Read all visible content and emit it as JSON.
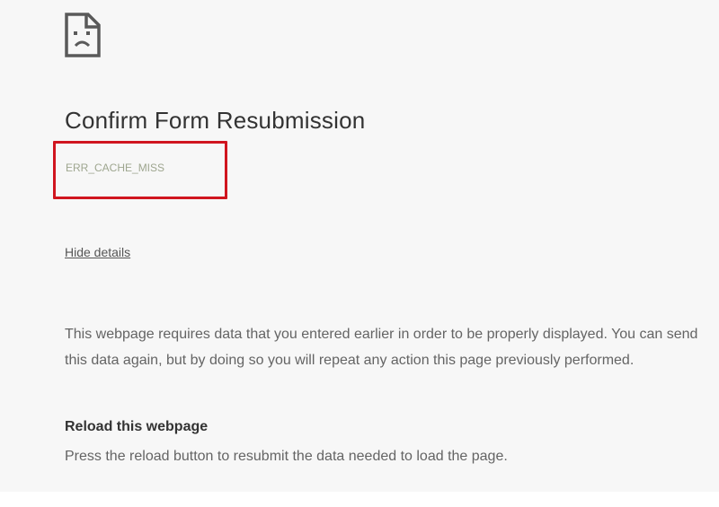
{
  "error_page": {
    "icon": "sad-document-icon",
    "title": "Confirm Form Resubmission",
    "error_code": "ERR_CACHE_MISS",
    "details_link": "Hide details",
    "explanation": "This webpage requires data that you entered earlier in order to be properly displayed. You can send this data again, but by doing so you will repeat any action this page previously performed.",
    "reload_heading": "Reload this webpage",
    "reload_description": "Press the reload button to resubmit the data needed to load the page."
  },
  "colors": {
    "page_background": "#f7f7f7",
    "title_text": "#333333",
    "body_text": "#646464",
    "error_code_text": "#9ea68f",
    "highlight_border": "#d0151f"
  }
}
